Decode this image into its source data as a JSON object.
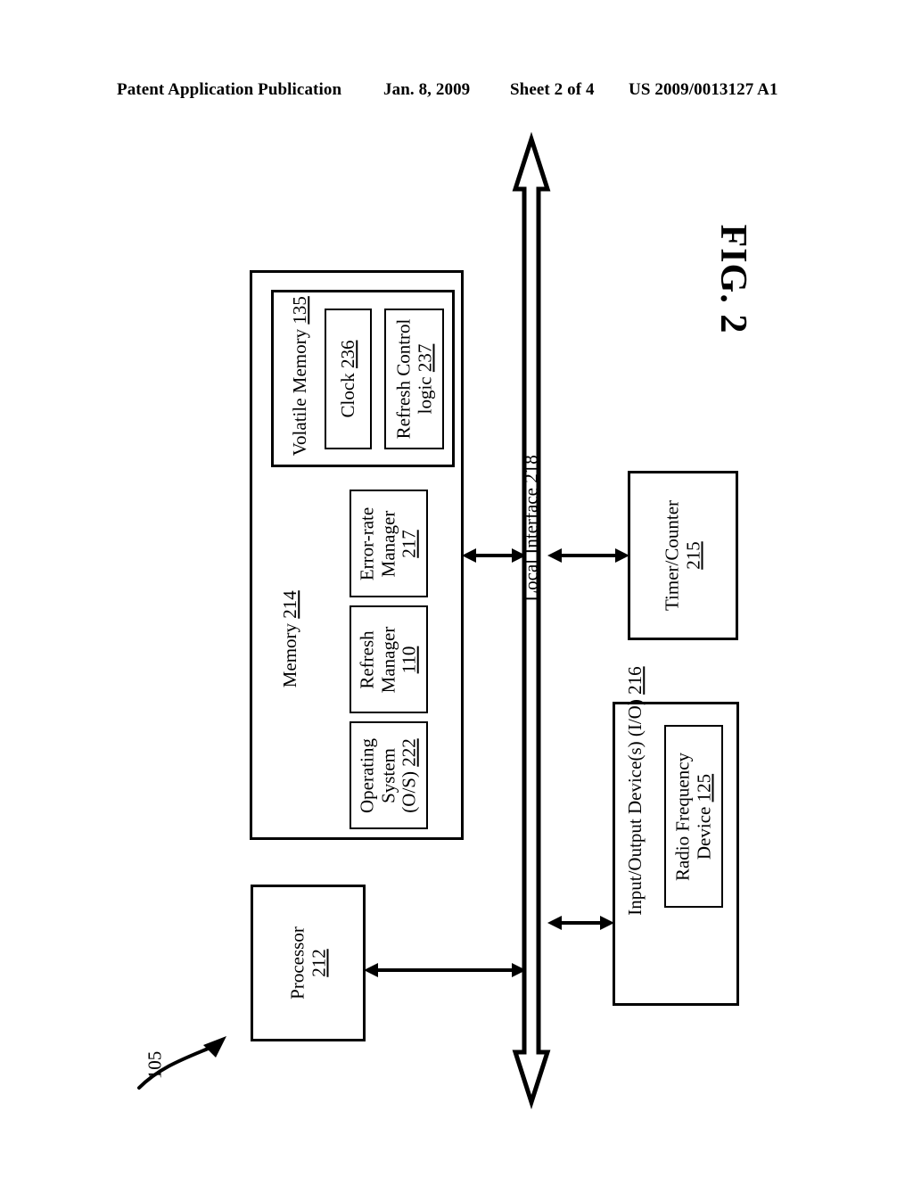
{
  "header": {
    "publication": "Patent Application Publication",
    "date": "Jan. 8, 2009",
    "sheet": "Sheet 2 of 4",
    "patent_number": "US 2009/0013127 A1"
  },
  "figure": {
    "label": "FIG. 2",
    "system_ref": "105"
  },
  "blocks": {
    "memory": {
      "name": "Memory",
      "ref": "214"
    },
    "volatile_memory": {
      "name": "Volatile Memory",
      "ref": "135"
    },
    "clock": {
      "name": "Clock",
      "ref": "236"
    },
    "refresh_control_logic": {
      "line1": "Refresh Control",
      "line2": "logic",
      "ref": "237"
    },
    "error_rate_manager": {
      "line1": "Error-rate",
      "line2": "Manager",
      "ref": "217"
    },
    "refresh_manager": {
      "line1": "Refresh",
      "line2": "Manager",
      "ref": "110"
    },
    "operating_system": {
      "line1": "Operating",
      "line2": "System",
      "line3": "(O/S)",
      "ref": "222"
    },
    "local_interface": {
      "name": "Local Interface",
      "ref": "218"
    },
    "timer_counter": {
      "name": "Timer/Counter",
      "ref": "215"
    },
    "io_devices": {
      "name": "Input/Output Device(s) (I/O)",
      "ref": "216"
    },
    "radio_frequency_device": {
      "line1": "Radio Frequency",
      "line2": "Device",
      "ref": "125"
    },
    "processor": {
      "name": "Processor",
      "ref": "212"
    }
  },
  "colors": {
    "stroke": "#000000",
    "background": "#ffffff"
  }
}
